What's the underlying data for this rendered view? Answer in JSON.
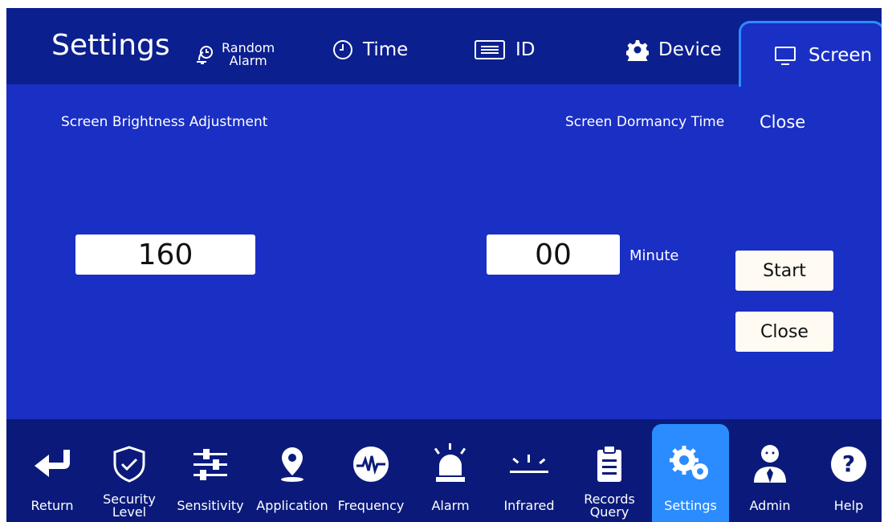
{
  "header": {
    "title": "Settings",
    "tabs": {
      "random_line1": "Random",
      "random_line2": "Alarm",
      "time": "Time",
      "id": "ID",
      "device": "Device",
      "screen": "Screen"
    }
  },
  "brightness": {
    "label": "Screen Brightness Adjustment",
    "value": "160"
  },
  "dormancy": {
    "label": "Screen Dormancy Time",
    "status": "Close",
    "value": "00",
    "unit": "Minute",
    "start_button": "Start",
    "close_button": "Close"
  },
  "nav": {
    "return": "Return",
    "security_line1": "Security",
    "security_line2": "Level",
    "sensitivity": "Sensitivity",
    "application": "Application",
    "frequency": "Frequency",
    "alarm": "Alarm",
    "infrared": "Infrared",
    "records_line1": "Records",
    "records_line2": "Query",
    "settings": "Settings",
    "admin": "Admin",
    "help": "Help"
  },
  "colors": {
    "background": "#1a2fc4",
    "header": "#0c1f8f",
    "nav": "#0b1a7a",
    "active": "#2b8cff"
  }
}
